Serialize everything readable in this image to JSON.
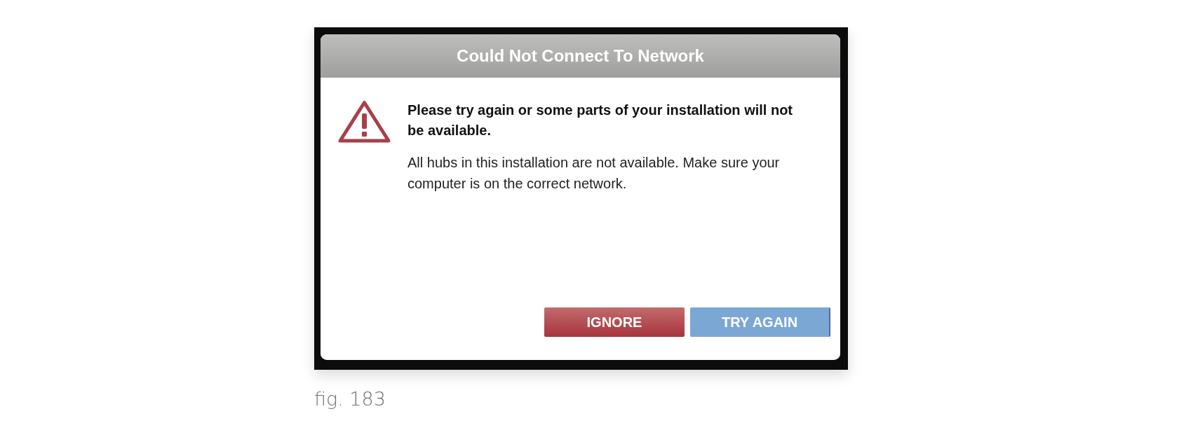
{
  "dialog": {
    "title": "Could Not Connect To Network",
    "heading": "Please try again or some parts of your installation will not be available.",
    "message": "All hubs in this installation are not available. Make sure your computer is on the correct network.",
    "buttons": [
      {
        "label": "IGNORE",
        "kind": "danger"
      },
      {
        "label": "TRY AGAIN",
        "kind": "primary"
      }
    ]
  },
  "caption": "fig. 183"
}
